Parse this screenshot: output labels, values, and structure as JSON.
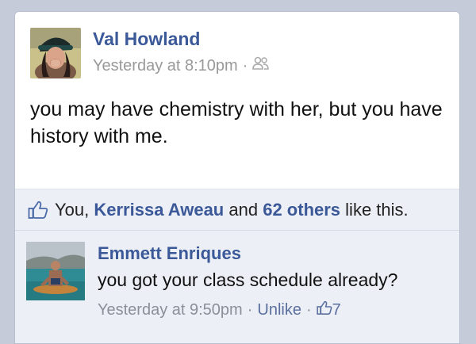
{
  "post": {
    "author": "Val Howland",
    "timestamp": "Yesterday at 8:10pm",
    "separator": "·",
    "privacy_icon": "friends-icon",
    "text": "you may have chemistry with her, but you have history with me."
  },
  "likes": {
    "you": "You,",
    "friend": "Kerrissa Aweau",
    "and": "and",
    "others": "62 others",
    "suffix": "like this."
  },
  "comment": {
    "author": "Emmett Enriques",
    "text": "you got your class schedule already?",
    "timestamp": "Yesterday at 9:50pm",
    "separator": "·",
    "unlike_label": "Unlike",
    "like_count": "7"
  },
  "colors": {
    "link": "#3b5998",
    "muted": "#999999",
    "background": "#c5cbd9",
    "comment_bg": "#eceff5"
  }
}
